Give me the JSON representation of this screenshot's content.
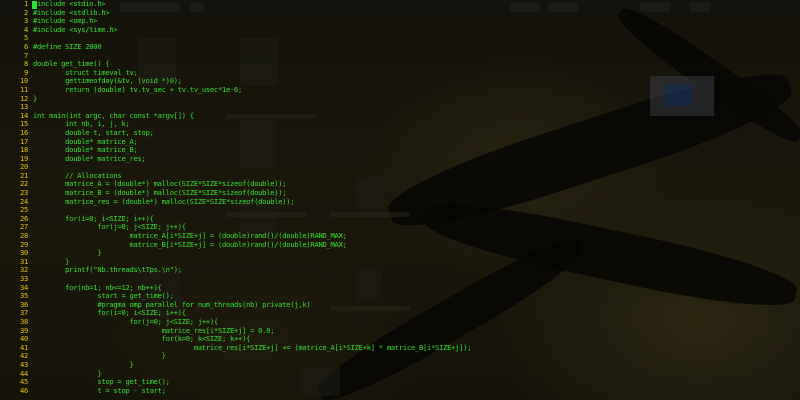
{
  "colors": {
    "code_text": "#33e433",
    "line_number": "#e6c21b",
    "background": "#0b0a05"
  },
  "editor": {
    "cursor_line": 1,
    "lines": [
      {
        "n": "1",
        "text": "#include <stdio.h>"
      },
      {
        "n": "2",
        "text": "#include <stdlib.h>"
      },
      {
        "n": "3",
        "text": "#include <omp.h>"
      },
      {
        "n": "4",
        "text": "#include <sys/time.h>"
      },
      {
        "n": "5",
        "text": ""
      },
      {
        "n": "6",
        "text": "#define SIZE 2000"
      },
      {
        "n": "7",
        "text": ""
      },
      {
        "n": "8",
        "text": "double get_time() {"
      },
      {
        "n": "9",
        "text": "        struct timeval tv;"
      },
      {
        "n": "10",
        "text": "        gettimeofday(&tv, (void *)0);"
      },
      {
        "n": "11",
        "text": "        return (double) tv.tv_sec + tv.tv_usec*1e-6;"
      },
      {
        "n": "12",
        "text": "}"
      },
      {
        "n": "13",
        "text": ""
      },
      {
        "n": "14",
        "text": "int main(int argc, char const *argv[]) {"
      },
      {
        "n": "15",
        "text": "        int nb, i, j, k;"
      },
      {
        "n": "16",
        "text": "        double t, start, stop;"
      },
      {
        "n": "17",
        "text": "        double* matrice_A;"
      },
      {
        "n": "18",
        "text": "        double* matrice_B;"
      },
      {
        "n": "19",
        "text": "        double* matrice_res;"
      },
      {
        "n": "20",
        "text": ""
      },
      {
        "n": "21",
        "text": "        // Allocations"
      },
      {
        "n": "22",
        "text": "        matrice_A = (double*) malloc(SIZE*SIZE*sizeof(double));"
      },
      {
        "n": "23",
        "text": "        matrice_B = (double*) malloc(SIZE*SIZE*sizeof(double));"
      },
      {
        "n": "24",
        "text": "        matrice_res = (double*) malloc(SIZE*SIZE*sizeof(double));"
      },
      {
        "n": "25",
        "text": ""
      },
      {
        "n": "26",
        "text": "        for(i=0; i<SIZE; i++){"
      },
      {
        "n": "27",
        "text": "                for(j=0; j<SIZE; j++){"
      },
      {
        "n": "28",
        "text": "                        matrice_A[i*SIZE+j] = (double)rand()/(double)RAND_MAX;"
      },
      {
        "n": "29",
        "text": "                        matrice_B[i*SIZE+j] = (double)rand()/(double)RAND_MAX;"
      },
      {
        "n": "30",
        "text": "                }"
      },
      {
        "n": "31",
        "text": "        }"
      },
      {
        "n": "32",
        "text": "        printf(\"Nb.threads\\tTps.\\n\");"
      },
      {
        "n": "33",
        "text": ""
      },
      {
        "n": "34",
        "text": "        for(nb=1; nb<=12; nb++){"
      },
      {
        "n": "35",
        "text": "                start = get_time();"
      },
      {
        "n": "36",
        "text": "                #pragma omp parallel for num_threads(nb) private(j,k)"
      },
      {
        "n": "37",
        "text": "                for(i=0; i<SIZE; i++){"
      },
      {
        "n": "38",
        "text": "                        for(j=0; j<SIZE; j++){"
      },
      {
        "n": "39",
        "text": "                                matrice_res[i*SIZE+j] = 0.0;"
      },
      {
        "n": "40",
        "text": "                                for(k=0; k<SIZE; k++){"
      },
      {
        "n": "41",
        "text": "                                        matrice_res[i*SIZE+j] += (matrice_A[i*SIZE+k] * matrice_B[i*SIZE+j]);"
      },
      {
        "n": "42",
        "text": "                                }"
      },
      {
        "n": "43",
        "text": "                        }"
      },
      {
        "n": "44",
        "text": "                }"
      },
      {
        "n": "45",
        "text": "                stop = get_time();"
      },
      {
        "n": "46",
        "text": "                t = stop - start;"
      }
    ]
  }
}
